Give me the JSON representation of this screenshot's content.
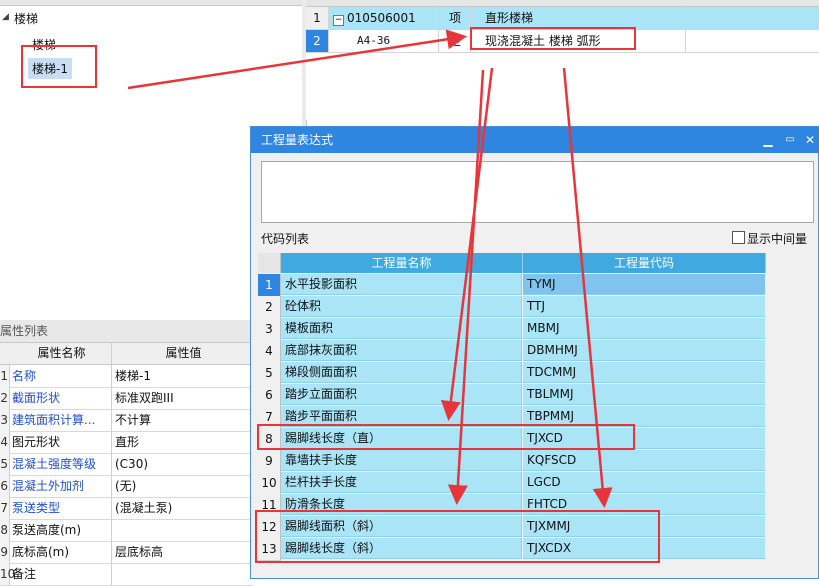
{
  "tree": {
    "root_label": "楼梯",
    "child_1": "楼梯",
    "child_2": "楼梯-1"
  },
  "top_grid": {
    "rows": [
      {
        "num": "1",
        "code": "010506001",
        "type": "项",
        "name": "直形楼梯"
      },
      {
        "num": "2",
        "code": "A4-36",
        "type": "定",
        "name": "现浇混凝土 楼梯 弧形"
      }
    ]
  },
  "properties": {
    "title": "属性列表",
    "col_name": "属性名称",
    "col_value": "属性值",
    "rows": [
      {
        "num": "1",
        "name": "名称",
        "value": "楼梯-1",
        "blue": true
      },
      {
        "num": "2",
        "name": "截面形状",
        "value": "标准双跑III",
        "blue": true
      },
      {
        "num": "3",
        "name": "建筑面积计算...",
        "value": "不计算",
        "blue": true
      },
      {
        "num": "4",
        "name": "图元形状",
        "value": "直形",
        "blue": false
      },
      {
        "num": "5",
        "name": "混凝土强度等级",
        "value": "(C30)",
        "blue": true
      },
      {
        "num": "6",
        "name": "混凝土外加剂",
        "value": "(无)",
        "blue": true
      },
      {
        "num": "7",
        "name": "泵送类型",
        "value": "(混凝土泵)",
        "blue": true
      },
      {
        "num": "8",
        "name": "泵送高度(m)",
        "value": "",
        "blue": false
      },
      {
        "num": "9",
        "name": "底标高(m)",
        "value": "层底标高",
        "blue": false
      },
      {
        "num": "10",
        "name": "备注",
        "value": "",
        "blue": false
      }
    ]
  },
  "dialog": {
    "title": "工程量表达式",
    "code_list_label": "代码列表",
    "show_intermediate_label": "显示中间量",
    "minimize_icon": "minimize-icon",
    "maximize_icon": "maximize-icon",
    "close_icon": "close-icon",
    "col_name": "工程量名称",
    "col_code": "工程量代码",
    "rows": [
      {
        "num": "1",
        "name": "水平投影面积",
        "code": "TYMJ"
      },
      {
        "num": "2",
        "name": "砼体积",
        "code": "TTJ"
      },
      {
        "num": "3",
        "name": "模板面积",
        "code": "MBMJ"
      },
      {
        "num": "4",
        "name": "底部抹灰面积",
        "code": "DBMHMJ"
      },
      {
        "num": "5",
        "name": "梯段侧面面积",
        "code": "TDCMMJ"
      },
      {
        "num": "6",
        "name": "踏步立面面积",
        "code": "TBLMMJ"
      },
      {
        "num": "7",
        "name": "踏步平面面积",
        "code": "TBPMMJ"
      },
      {
        "num": "8",
        "name": "踢脚线长度（直）",
        "code": "TJXCD"
      },
      {
        "num": "9",
        "name": "靠墙扶手长度",
        "code": "KQFSCD"
      },
      {
        "num": "10",
        "name": "栏杆扶手长度",
        "code": "LGCD"
      },
      {
        "num": "11",
        "name": "防滑条长度",
        "code": "FHTCD"
      },
      {
        "num": "12",
        "name": "踢脚线面积（斜）",
        "code": "TJXMMJ"
      },
      {
        "num": "13",
        "name": "踢脚线长度（斜）",
        "code": "TJXCDX"
      }
    ]
  },
  "colors": {
    "accent": "#2f86e0",
    "grid_cell": "#a9e4f7",
    "annotation": "#e8353a",
    "property_link": "#1f4fd6"
  }
}
